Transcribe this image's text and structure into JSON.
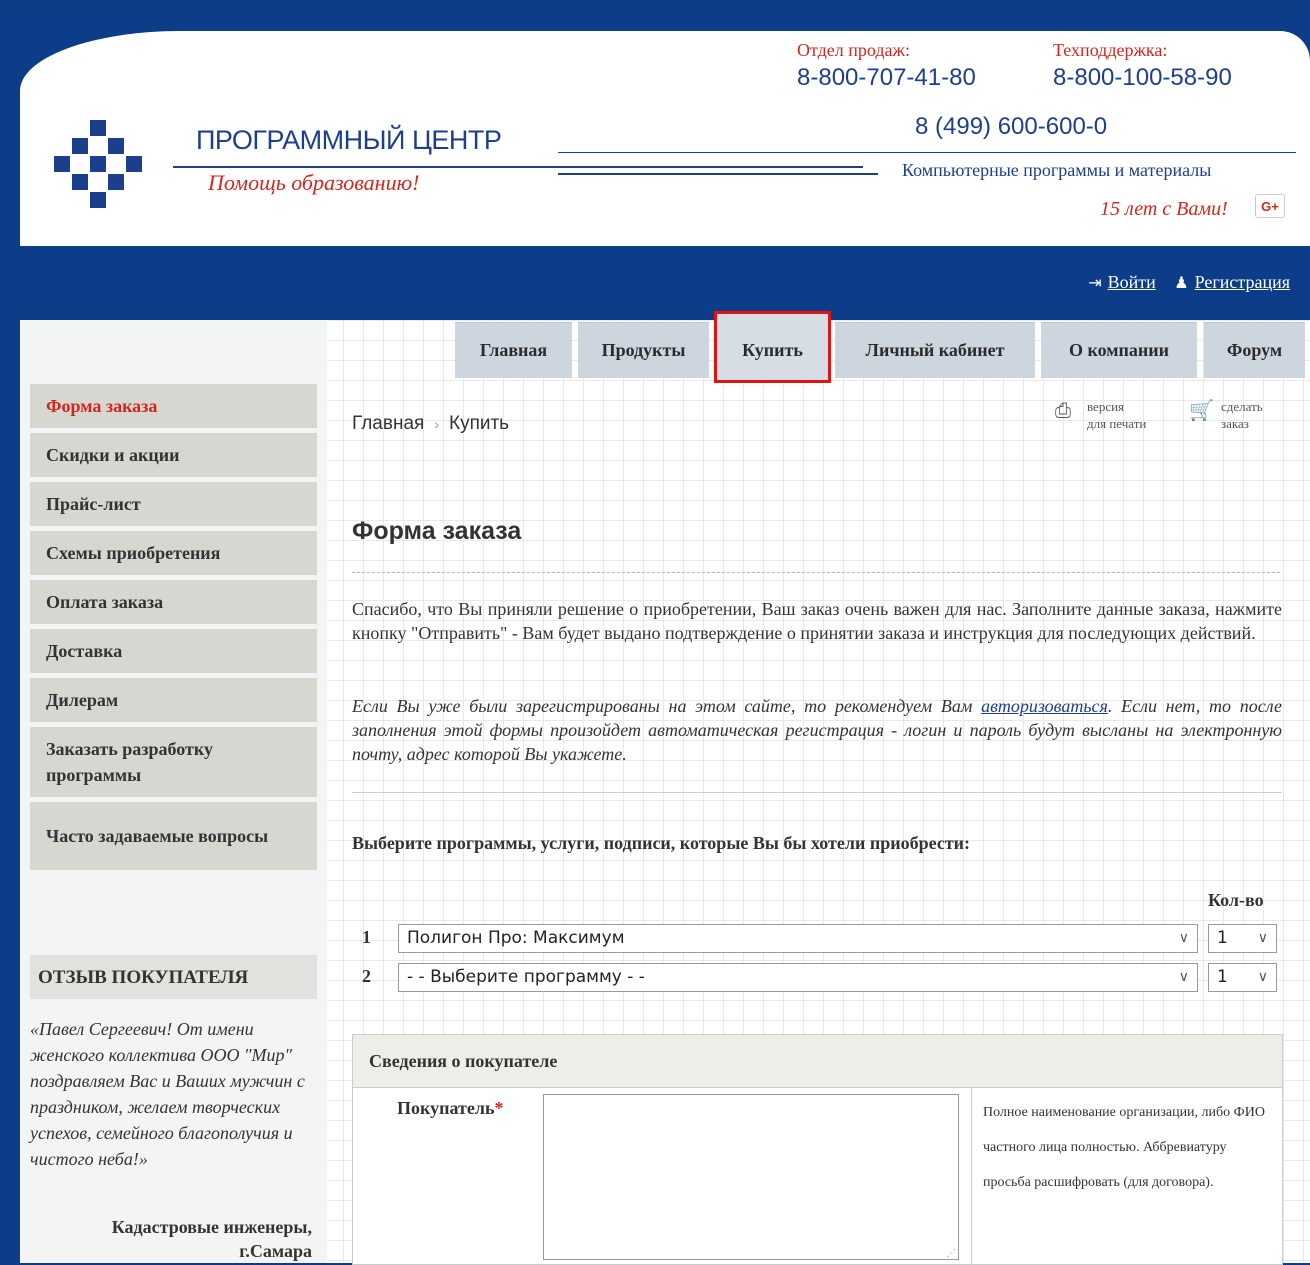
{
  "header": {
    "brand_title": "ПРОГРАММНЫЙ ЦЕНТР",
    "brand_slogan": "Помощь образованию!",
    "sales_label": "Отдел продаж:",
    "sales_phone": "8-800-707-41-80",
    "support_label": "Техподдержка:",
    "support_phone": "8-800-100-58-90",
    "main_phone": "8 (499) 600-600-0",
    "tagline": "Компьютерные программы и материалы",
    "years": "15 лет с Вами!",
    "gplus": "G+"
  },
  "userbar": {
    "login": "Войти",
    "register": "Регистрация"
  },
  "nav": {
    "tabs": [
      "Главная",
      "Продукты",
      "Купить",
      "Личный кабинет",
      "О компании",
      "Форум"
    ],
    "active": "Купить"
  },
  "sidebar": {
    "items": [
      "Форма заказа",
      "Скидки и акции",
      "Прайс-лист",
      "Схемы приобретения",
      "Оплата заказа",
      "Доставка",
      "Дилерам",
      "Заказать разработку программы",
      "Часто задаваемые вопросы"
    ],
    "review_title": "ОТЗЫВ ПОКУПАТЕЛЯ",
    "review_text": "«Павел Сергеевич! От имени женского коллектива ООО \"Мир\" поздравляем Вас и Ваших мужчин с праздником, желаем творческих успехов, семейного благополучия и чистого неба!»",
    "review_author_1": "Кадастровые инженеры,",
    "review_author_2": "г.Самара"
  },
  "breadcrumb": {
    "home": "Главная",
    "current": "Купить"
  },
  "tools": {
    "print_1": "версия",
    "print_2": "для печати",
    "order_1": "сделать",
    "order_2": "заказ"
  },
  "content": {
    "title": "Форма заказа",
    "intro": "Спасибо, что Вы приняли решение о приобретении, Ваш заказ очень важен для нас. Заполните данные заказа, нажмите кнопку \"Отправить\" - Вам будет выдано подтверждение о принятии заказа и инструкция для последующих действий.",
    "note_before": "Если Вы уже были зарегистрированы на этом сайте, то рекомендуем Вам ",
    "note_link": "авторизоваться",
    "note_after": ". Если нет, то после заполнения этой формы произойдет автоматическая регистрация - логин и пароль будут высланы на электронную почту, адрес которой Вы укажете.",
    "pick_heading": "Выберите программы, услуги, подписи, которые Вы бы хотели приобрести:",
    "qty_heading": "Кол-во",
    "rows": [
      {
        "num": "1",
        "program": "Полигон Про: Максимум",
        "qty": "1"
      },
      {
        "num": "2",
        "program": "- - Выберите программу - -",
        "qty": "1"
      }
    ]
  },
  "buyer": {
    "heading": "Сведения о покупателе",
    "label": "Покупатель",
    "required_mark": "*",
    "hint": "Полное наименование организации, либо ФИО частного лица полностью. Аббревиатуру просьба расшифровать (для договора)."
  }
}
